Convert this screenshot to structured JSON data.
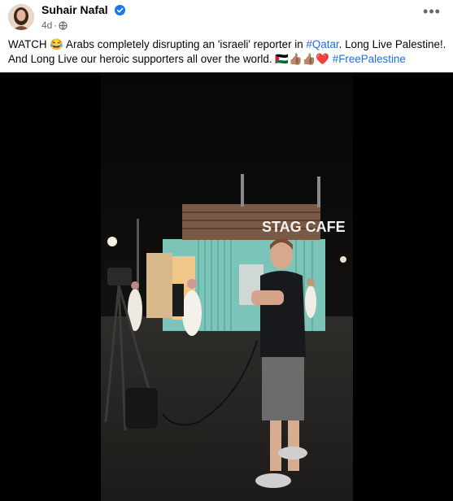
{
  "post": {
    "author": "Suhair Nafal",
    "time": "4d",
    "separator": "·",
    "more_label": "•••",
    "caption": {
      "line1_prefix": "WATCH",
      "emoji_laugh": "😂",
      "line1_mid": "Arabs completely disrupting an 'israeli' reporter in",
      "hashtag_qatar": "#Qatar",
      "line1_suffix": ". Long Live Palestine!. And",
      "line2_text": "Long Live our heroic supporters all over the world.",
      "line2_emojis": "🇵🇸👍🏽👍🏽",
      "heart": "❤️",
      "hashtag_free": "#FreePalestine"
    },
    "video": {
      "sign_text": "STAG CAFE"
    }
  },
  "colors": {
    "link": "#216fdb",
    "meta": "#65676b",
    "verified": "#1877f2",
    "container": "#7bc4b8"
  },
  "icons": [
    "verified-badge-icon",
    "globe-icon",
    "more-options-icon"
  ]
}
